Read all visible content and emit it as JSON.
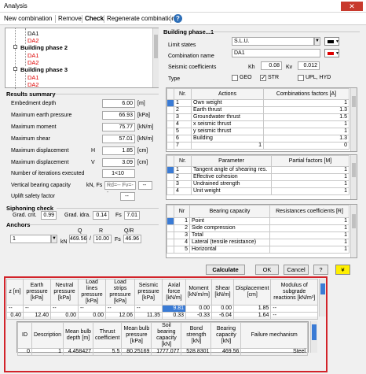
{
  "window": {
    "title": "Analysis",
    "close": "✕"
  },
  "menu": {
    "items": [
      "New combination",
      "Remove",
      "Check",
      "Regenerate combination"
    ],
    "help": "?"
  },
  "tree": {
    "items": [
      {
        "label": "DA1",
        "color": "#000",
        "level": 2
      },
      {
        "label": "DA2",
        "color": "#d00",
        "level": 2
      },
      {
        "label": "Building phase 2",
        "color": "#000",
        "level": 1
      },
      {
        "label": "DA1",
        "color": "#d00",
        "level": 2
      },
      {
        "label": "DA2",
        "color": "#d00",
        "level": 2
      },
      {
        "label": "Building phase 3",
        "color": "#000",
        "level": 1
      },
      {
        "label": "DA1",
        "color": "#d00",
        "level": 2
      },
      {
        "label": "DA2",
        "color": "#d00",
        "level": 2
      }
    ]
  },
  "phase": {
    "title": "Building phase...1",
    "limit_states_label": "Limit states",
    "limit_states_value": "S.L.U.",
    "combination_name_label": "Combination name",
    "combination_name_value": "DA1",
    "seismic_label": "Seismic coefficients",
    "kh_label": "Kh",
    "kh_value": "0.08",
    "kv_label": "Kv",
    "kv_value": "0.012",
    "type_label": "Type",
    "types": [
      {
        "label": "GEO",
        "checked": false
      },
      {
        "label": "STR",
        "checked": true
      },
      {
        "label": "UPL, HYD",
        "checked": false
      }
    ]
  },
  "actions": {
    "headers": [
      "Nr.",
      "Actions",
      "Combinations factors [A]"
    ],
    "rows": [
      [
        "1",
        "Own weight",
        "1"
      ],
      [
        "2",
        "Earth thrust",
        "1.3"
      ],
      [
        "3",
        "Groundwater thrust",
        "1.5"
      ],
      [
        "4",
        "x seismic thrust",
        "1"
      ],
      [
        "5",
        "y seismic thrust",
        "1"
      ],
      [
        "6",
        "Building",
        "1.3"
      ],
      [
        "7",
        "1",
        "0"
      ]
    ]
  },
  "partial": {
    "headers": [
      "Nr.",
      "Parameter",
      "Partial factors [M]"
    ],
    "rows": [
      [
        "1",
        "Tangent angle of shearing res.",
        "1"
      ],
      [
        "2",
        "Effective cohesion",
        "1"
      ],
      [
        "3",
        "Undrained strength",
        "1"
      ],
      [
        "4",
        "Unit weight",
        "1"
      ]
    ]
  },
  "bearing": {
    "headers": [
      "Nr",
      "Bearing capacity",
      "Resistances coefficients [R]"
    ],
    "rows": [
      [
        "1",
        "Point",
        "1"
      ],
      [
        "2",
        "Side compression",
        "1"
      ],
      [
        "3",
        "Total",
        "1"
      ],
      [
        "4",
        "Lateral (tensile resistance)",
        "1"
      ],
      [
        "5",
        "Horizontal",
        "1"
      ]
    ]
  },
  "results": {
    "title": "Results summary",
    "rows": [
      {
        "label": "Embedment depth",
        "sym": "",
        "value": "6.00",
        "unit": "[m]"
      },
      {
        "label": "Maximum earth pressure",
        "sym": "",
        "value": "66.93",
        "unit": "[kPa]"
      },
      {
        "label": "Maximum moment",
        "sym": "",
        "value": "75.77",
        "unit": "[kN/m]"
      },
      {
        "label": "Maximum shear",
        "sym": "",
        "value": "57.01",
        "unit": "[kN/m]"
      },
      {
        "label": "Maximum displacement",
        "sym": "H",
        "value": "1.85",
        "unit": "[cm]"
      },
      {
        "label": "Maximum displacement",
        "sym": "V",
        "value": "3.09",
        "unit": "[cm]"
      },
      {
        "label": "Number of iterations executed",
        "sym": "",
        "value": "1<10",
        "unit": ""
      },
      {
        "label": "Vertical bearing capacity",
        "sym": "kN, Fs",
        "value": "Rd=--  Fv=--",
        "unit": "--"
      },
      {
        "label": "Uplift safety factor",
        "sym": "",
        "value": "--",
        "unit": ""
      }
    ]
  },
  "siphoning": {
    "title": "Siphoning check",
    "grad_crit_label": "Grad. crit.",
    "grad_crit": "0.99",
    "grad_idra_label": "Grad. idra.",
    "grad_idra": "0.14",
    "fs_label": "Fs",
    "fs": "7.01"
  },
  "anchors": {
    "title": "Anchors",
    "select": "1",
    "q_label": "Q",
    "r_label": "R",
    "qr_label": "Q/R",
    "kn": "kN",
    "q": "469.56",
    "slash": "/",
    "r": "10.00",
    "fs_label": "Fs",
    "qr": "46.96"
  },
  "buttons": {
    "calculate": "Calculate",
    "ok": "OK",
    "cancel": "Cancel",
    "help": "?",
    "extra": "¥"
  },
  "detail": {
    "headers": [
      "z [m]",
      "Earth pressure [kPa]",
      "Neutral pressure [kPa]",
      "Load lines pressure [kPa]",
      "Load strips pressure [kPa]",
      "Seismic pressure [kPa]",
      "Axial force [kN/m]",
      "Moment [kN/m/m]",
      "Shear [kN/m]",
      "Displacement [cm]",
      "Modulus of subgrade reactions [kN/m³]"
    ],
    "rows": [
      [
        "--",
        "--",
        "--",
        "--",
        "--",
        "--",
        "9.81",
        "0.00",
        "0.00",
        "1.85",
        "--"
      ],
      [
        "0.40",
        "12.40",
        "0.00",
        "0.00",
        "12.06",
        "11.35",
        "0.33",
        "-0.33",
        "-6.04",
        "1.64",
        "--"
      ]
    ]
  },
  "bulb": {
    "headers": [
      "ID",
      "Description",
      "Mean bulb depth [m]",
      "Thrust coefficient",
      "Mean bulb pressure [kPa]",
      "Soil bearing capacity [kN]",
      "Bond strength [kN]",
      "Bearing capacity [kN]",
      "Failure mechanism"
    ],
    "rows": [
      [
        "0",
        "1",
        "4.458427",
        "5.5",
        "80.25169",
        "1777.077",
        "528.8301",
        "469.56",
        "Steel"
      ]
    ]
  },
  "colors": {
    "accent": "#3a7bd5",
    "highlight_border": "#d2232a",
    "close": "#c8392c"
  }
}
